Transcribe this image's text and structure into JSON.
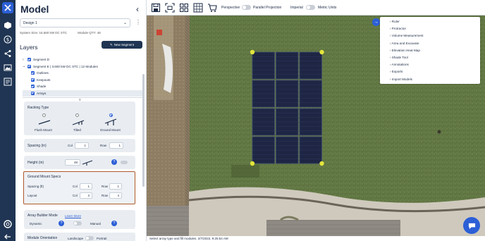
{
  "panel": {
    "title": "Model",
    "design": "Design 1",
    "system_size": "System Size: 16.560 kW DC STC",
    "module_qty": "Module QTY: 48",
    "layers_heading": "Layers",
    "new_segment": "New Segment",
    "tree": [
      {
        "label": "Segment D",
        "indent": 0
      },
      {
        "label": "Segment E | 3.600 kW DC STC | 12 Modules",
        "indent": 0
      },
      {
        "label": "Outlines",
        "indent": 1
      },
      {
        "label": "Keepouts",
        "indent": 1
      },
      {
        "label": "Shade",
        "indent": 1
      },
      {
        "label": "Arrays",
        "indent": 1
      }
    ],
    "racking": {
      "heading": "Racking Type",
      "options": [
        "Flush Mount",
        "Tilted",
        "Ground Mount"
      ],
      "selected": "Ground Mount"
    },
    "spacing": {
      "label": "Spacing (in)",
      "col_label": "Col",
      "col": "1",
      "row_label": "Row",
      "row": "1"
    },
    "height": {
      "label": "Height (in)",
      "value": "48"
    },
    "ground_specs": {
      "heading": "Ground Mount Specs",
      "spacing_label": "Spacing (ft)",
      "spacing_col_label": "Col",
      "spacing_col": "1",
      "spacing_row_label": "Row",
      "spacing_row": "1",
      "layout_label": "Layout",
      "layout_col_label": "Col",
      "layout_col": "3",
      "layout_row_label": "Row",
      "layout_row": "4"
    },
    "builder": {
      "label": "Array Builder Mode",
      "learn_more": "Learn More",
      "dynamic": "Dynamic",
      "manual": "Manual"
    },
    "orientation": {
      "label": "Module Orientation",
      "landscape": "Landscape",
      "portrait": "Portrait"
    }
  },
  "toolbar": {
    "perspective": "Perspective",
    "parallel": "Parallel Projection",
    "imperial": "Imperial",
    "metric": "Metric Units"
  },
  "tools_menu": [
    "Ruler",
    "Protractor",
    "Volume Measurement",
    "Area and Excavate",
    "Elevation Heat Map",
    "Shade Tool",
    "Annotations",
    "Exports",
    "Import Models"
  ],
  "status": "Select array type and fill modules. 2/7/2022, 9:25:54 AM",
  "array": {
    "rows": 4,
    "cols": 3,
    "modules": 12
  },
  "colors": {
    "nav": "#1f3553",
    "accent": "#2c5fd6",
    "highlight": "#b05a2a"
  }
}
